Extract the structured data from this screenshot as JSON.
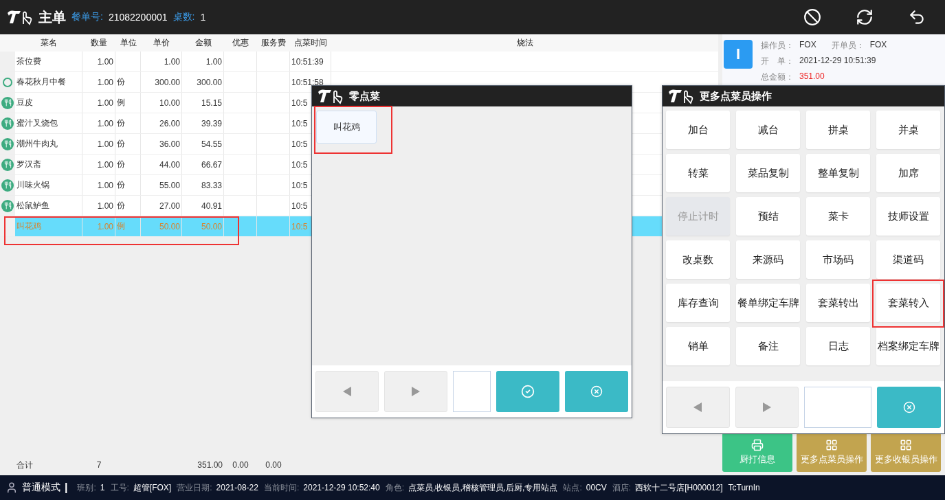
{
  "header": {
    "title": "主单",
    "order_label": "餐单号:",
    "order_no": "21082200001",
    "tables_label": "桌数:",
    "tables": "1"
  },
  "table": {
    "columns": [
      "菜名",
      "数量",
      "单位",
      "单价",
      "金额",
      "优惠",
      "服务费",
      "点菜时间",
      "烧法"
    ],
    "rows": [
      {
        "kind": "none",
        "name": "茶位费",
        "qty": "1.00",
        "unit": "",
        "price": "1.00",
        "amount": "1.00",
        "time": "10:51:39",
        "selected": false,
        "highlighted": false
      },
      {
        "kind": "ring",
        "name": "春花秋月中餐",
        "qty": "1.00",
        "unit": "份",
        "price": "300.00",
        "amount": "300.00",
        "time": "10:51:58",
        "selected": false,
        "highlighted": false
      },
      {
        "kind": "dish",
        "name": "豆皮",
        "qty": "1.00",
        "unit": "例",
        "price": "10.00",
        "amount": "15.15",
        "time": "10:5",
        "selected": false,
        "highlighted": false
      },
      {
        "kind": "dish",
        "name": "蜜汁叉烧包",
        "qty": "1.00",
        "unit": "份",
        "price": "26.00",
        "amount": "39.39",
        "time": "10:5",
        "selected": false,
        "highlighted": false
      },
      {
        "kind": "dish",
        "name": "潮州牛肉丸",
        "qty": "1.00",
        "unit": "份",
        "price": "36.00",
        "amount": "54.55",
        "time": "10:5",
        "selected": false,
        "highlighted": false
      },
      {
        "kind": "dish",
        "name": "罗汉斋",
        "qty": "1.00",
        "unit": "份",
        "price": "44.00",
        "amount": "66.67",
        "time": "10:5",
        "selected": false,
        "highlighted": false
      },
      {
        "kind": "dish",
        "name": "川味火锅",
        "qty": "1.00",
        "unit": "份",
        "price": "55.00",
        "amount": "83.33",
        "time": "10:5",
        "selected": false,
        "highlighted": false
      },
      {
        "kind": "dish",
        "name": "松鼠鲈鱼",
        "qty": "1.00",
        "unit": "份",
        "price": "27.00",
        "amount": "40.91",
        "time": "10:5",
        "selected": false,
        "highlighted": false
      },
      {
        "kind": "none",
        "name": "叫花鸡",
        "qty": "1.00",
        "unit": "例",
        "price": "50.00",
        "amount": "50.00",
        "time": "10:5",
        "selected": true,
        "highlighted": true
      }
    ],
    "totals": {
      "label": "合计",
      "qty": "7",
      "amount": "351.00",
      "discount": "0.00",
      "service": "0.00"
    }
  },
  "info_card": {
    "badge": "I",
    "rows": [
      {
        "fields": [
          {
            "label": "操作员：",
            "value": "FOX",
            "kind": "text"
          },
          {
            "label": "开单员：",
            "value": "FOX",
            "kind": "text"
          }
        ]
      },
      {
        "fields": [
          {
            "label": "开　单：",
            "value": "2021-12-29 10:51:39",
            "kind": "text"
          }
        ]
      },
      {
        "fields": [
          {
            "label": "总金额：",
            "value": "351.00",
            "kind": "amount"
          }
        ]
      }
    ]
  },
  "side_buttons": [
    {
      "label": "厨打信息",
      "kind": "print"
    },
    {
      "label": "更多点菜员操作",
      "kind": "grid"
    },
    {
      "label": "更多收银员操作",
      "kind": "grid"
    }
  ],
  "dish_dialog": {
    "title": "零点菜",
    "items": [
      {
        "label": "叫花鸡",
        "highlighted": true
      }
    ]
  },
  "ops_dialog": {
    "title": "更多点菜员操作",
    "buttons": [
      {
        "label": "加台",
        "disabled": false,
        "highlighted": false
      },
      {
        "label": "减台",
        "disabled": false,
        "highlighted": false
      },
      {
        "label": "拼桌",
        "disabled": false,
        "highlighted": false
      },
      {
        "label": "并桌",
        "disabled": false,
        "highlighted": false
      },
      {
        "label": "转菜",
        "disabled": false,
        "highlighted": false
      },
      {
        "label": "菜品复制",
        "disabled": false,
        "highlighted": false
      },
      {
        "label": "整单复制",
        "disabled": false,
        "highlighted": false
      },
      {
        "label": "加席",
        "disabled": false,
        "highlighted": false
      },
      {
        "label": "停止计时",
        "disabled": true,
        "highlighted": false
      },
      {
        "label": "预结",
        "disabled": false,
        "highlighted": false
      },
      {
        "label": "菜卡",
        "disabled": false,
        "highlighted": false
      },
      {
        "label": "技师设置",
        "disabled": false,
        "highlighted": false
      },
      {
        "label": "改桌数",
        "disabled": false,
        "highlighted": false
      },
      {
        "label": "来源码",
        "disabled": false,
        "highlighted": false
      },
      {
        "label": "市场码",
        "disabled": false,
        "highlighted": false
      },
      {
        "label": "渠道码",
        "disabled": false,
        "highlighted": false
      },
      {
        "label": "库存查询",
        "disabled": false,
        "highlighted": false
      },
      {
        "label": "餐单绑定车牌",
        "disabled": false,
        "highlighted": false
      },
      {
        "label": "套菜转出",
        "disabled": false,
        "highlighted": false
      },
      {
        "label": "套菜转入",
        "disabled": false,
        "highlighted": true
      },
      {
        "label": "销单",
        "disabled": false,
        "highlighted": false
      },
      {
        "label": "备注",
        "disabled": false,
        "highlighted": false
      },
      {
        "label": "日志",
        "disabled": false,
        "highlighted": false
      },
      {
        "label": "档案绑定车牌",
        "disabled": false,
        "highlighted": false
      }
    ]
  },
  "status_bar": {
    "mode": "普通模式",
    "separator": "|",
    "items": [
      {
        "label": "班别:",
        "value": "1"
      },
      {
        "label": "工号:",
        "value": "超管[FOX]"
      },
      {
        "label": "营业日期:",
        "value": "2021-08-22"
      },
      {
        "label": "当前时间:",
        "value": "2021-12-29 10:52:40"
      },
      {
        "label": "角色:",
        "value": "点菜员,收银员,稽核管理员,后厨,专用站点"
      },
      {
        "label": "站点:",
        "value": "00CV"
      },
      {
        "label": "酒店:",
        "value": "西软十二号店[H000012]"
      }
    ],
    "tail": "TcTurnIn"
  }
}
